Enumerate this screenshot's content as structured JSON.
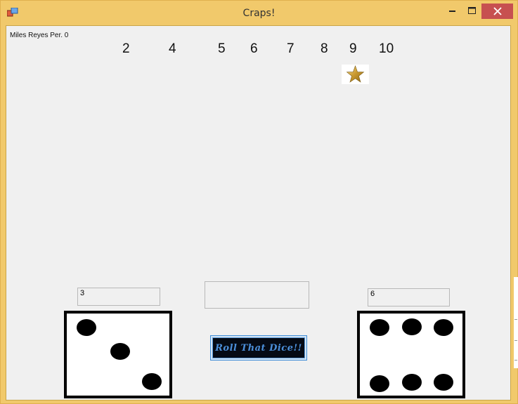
{
  "window": {
    "title": "Craps!",
    "controls": {
      "minimize": "🗕",
      "maximize": "🗖",
      "close": "✕"
    }
  },
  "author_label": "Miles Reyes Per. 0",
  "point_numbers": [
    "2",
    "4",
    "5",
    "6",
    "7",
    "8",
    "9",
    "10"
  ],
  "star_marker": {
    "icon": "star-icon",
    "position_number": "9"
  },
  "textboxes": {
    "die1_value": "3",
    "result": "",
    "die2_value": "6"
  },
  "dice": {
    "left": {
      "value": 3
    },
    "right": {
      "value": 6
    }
  },
  "roll_button": {
    "label": "Roll That Dice!!"
  },
  "colors": {
    "window_frame": "#f1c96b",
    "client_bg": "#f0f0f0",
    "close_button": "#c75050",
    "button_text": "#4b8ed8",
    "button_bg": "#050a14"
  }
}
